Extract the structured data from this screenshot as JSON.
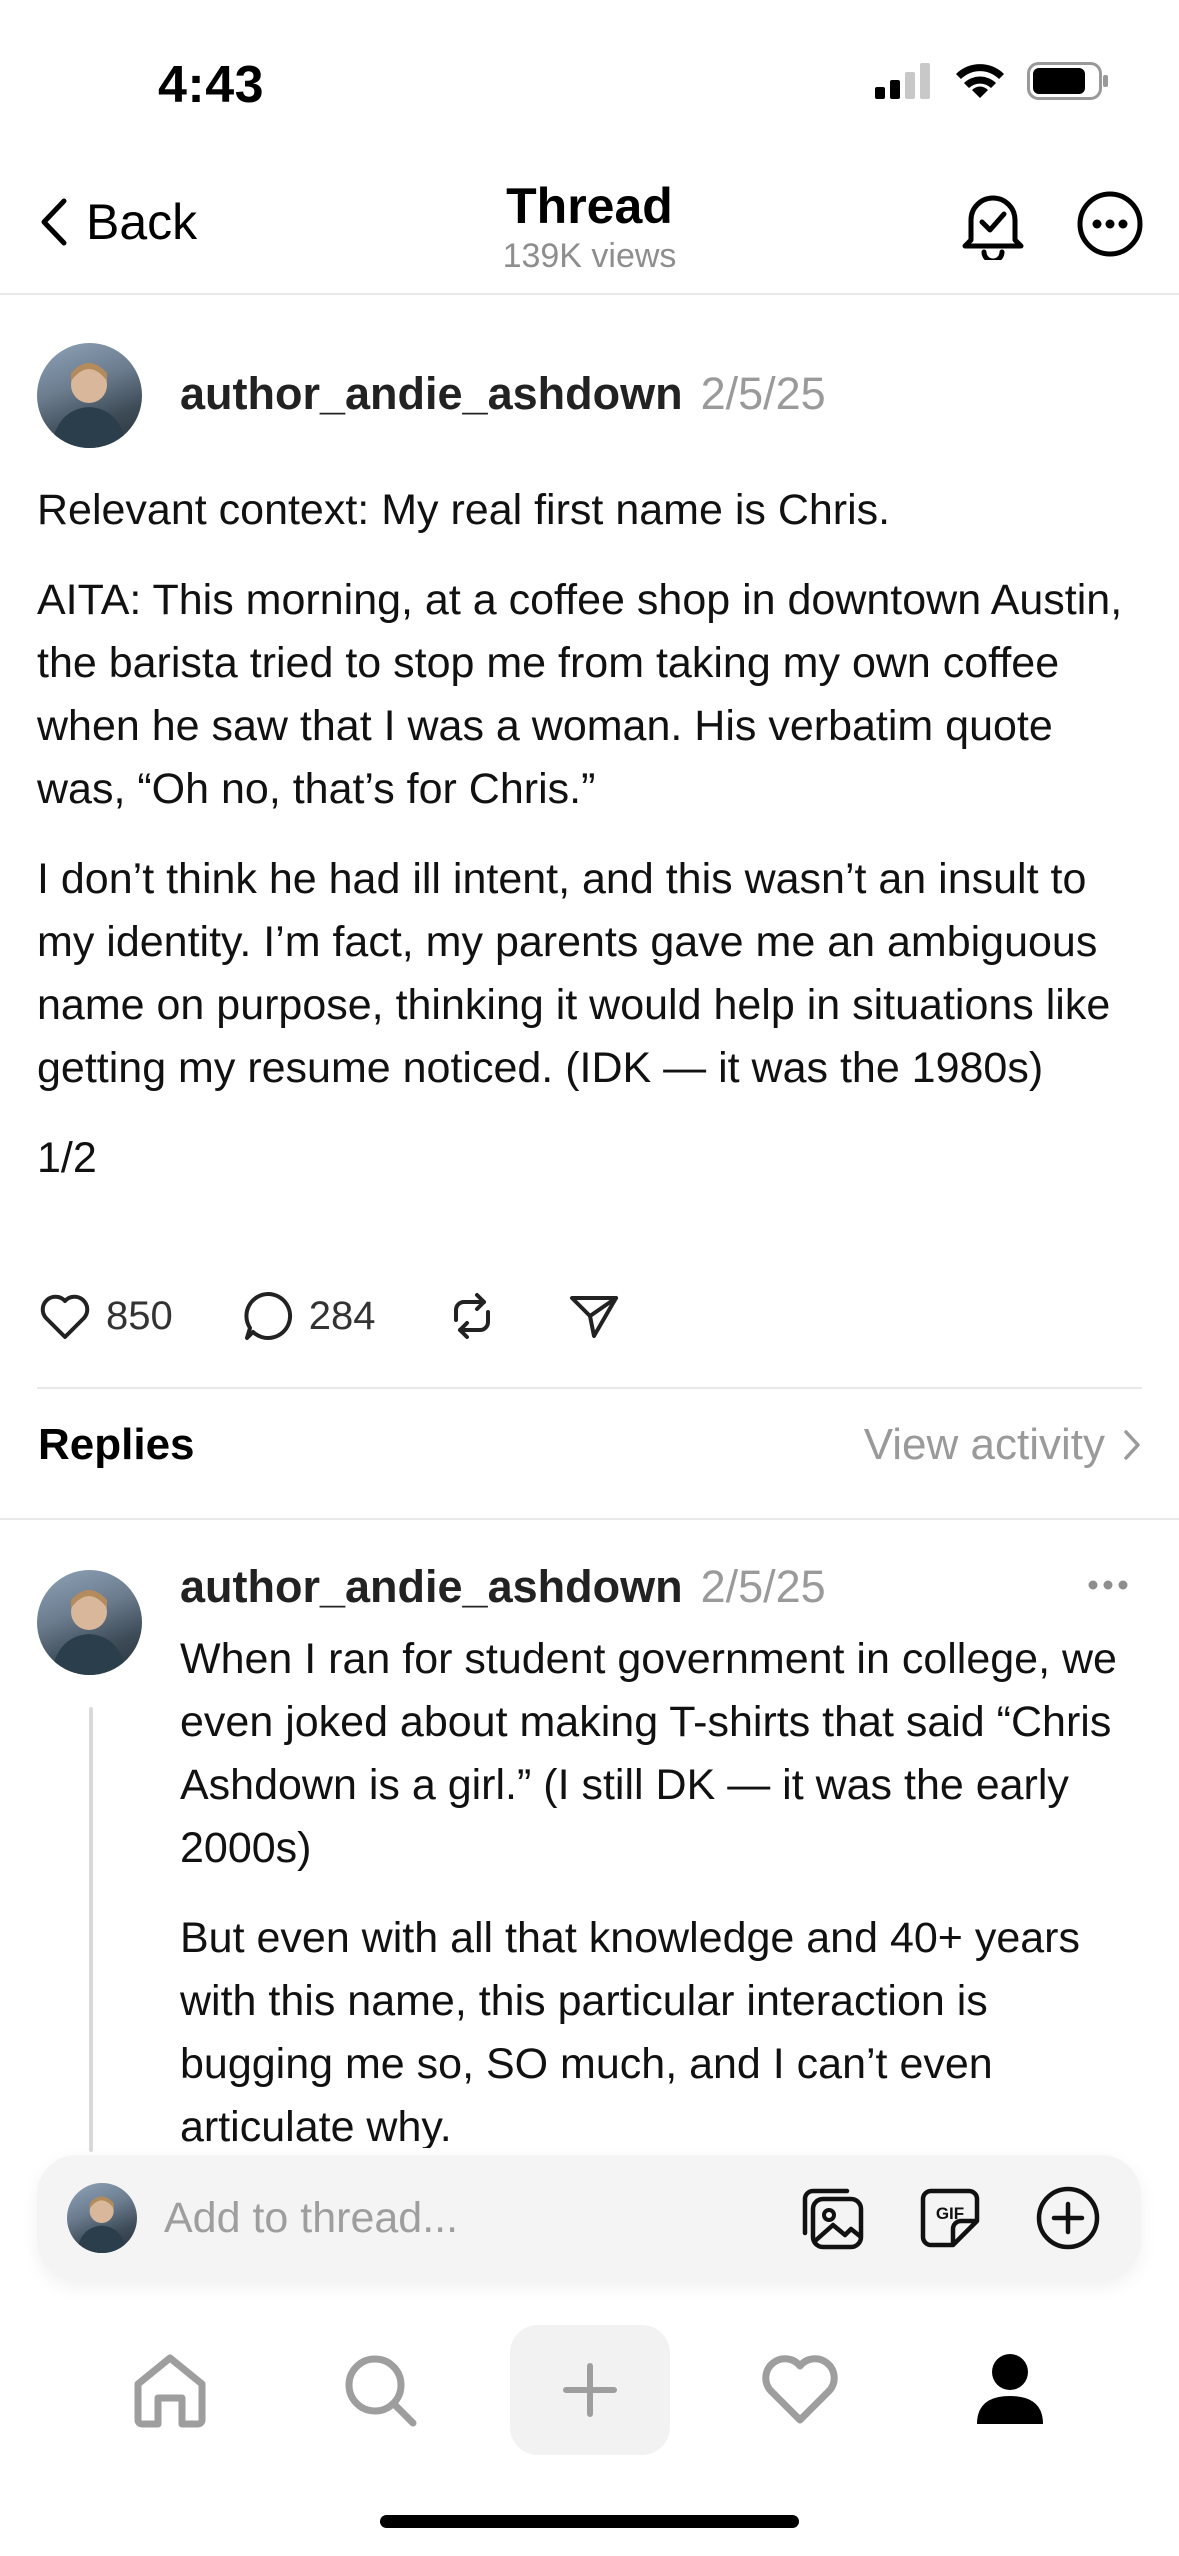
{
  "status_bar": {
    "time": "4:43"
  },
  "header": {
    "back_label": "Back",
    "title": "Thread",
    "views": "139K views"
  },
  "post": {
    "author": "author_andie_ashdown",
    "date": "2/5/25",
    "paragraphs": [
      "Relevant context: My real first name is Chris.",
      "AITA: This morning, at a coffee shop in downtown Austin, the barista tried to stop me from taking my own coffee when he saw that I was a woman. His verbatim quote was, “Oh no, that’s for Chris.”",
      "I don’t think he had ill intent, and this wasn’t an insult to my identity. I’m fact, my parents gave me an ambiguous name on purpose, thinking it would help in situations like getting my resume noticed. (IDK — it was the 1980s)",
      "1/2"
    ],
    "likes": "850",
    "comments": "284"
  },
  "replies_section": {
    "label": "Replies",
    "view_activity": "View activity"
  },
  "reply": {
    "author": "author_andie_ashdown",
    "date": "2/5/25",
    "paragraphs": [
      "When I ran for student government in college, we even joked about making T-shirts that said “Chris Ashdown is a girl.” (I still DK — it was the early 2000s)",
      "But even with all that knowledge and 40+ years with this name, this particular interaction is bugging me so, SO much, and I can’t even articulate why."
    ]
  },
  "composer": {
    "placeholder": "Add to thread..."
  },
  "tabbar": {
    "items": [
      "home-icon",
      "search-icon",
      "create-icon",
      "activity-icon",
      "profile-icon"
    ]
  }
}
